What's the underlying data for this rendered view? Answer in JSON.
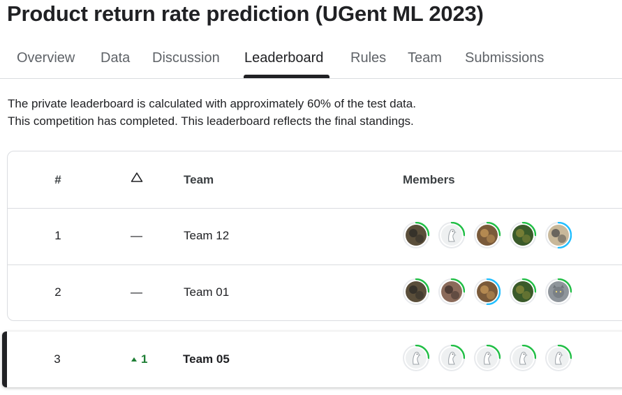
{
  "page": {
    "title": "Product return rate prediction (UGent ML 2023)"
  },
  "tabs": [
    {
      "label": "Overview"
    },
    {
      "label": "Data"
    },
    {
      "label": "Discussion"
    },
    {
      "label": "Leaderboard",
      "active": true
    },
    {
      "label": "Rules"
    },
    {
      "label": "Team"
    },
    {
      "label": "Submissions"
    }
  ],
  "description": {
    "line1": "The private leaderboard is calculated with approximately 60% of the test data.",
    "line2": "This competition has completed. This leaderboard reflects the final standings."
  },
  "leaderboard": {
    "headers": {
      "rank": "#",
      "delta_icon": "triangle-up-outline-icon",
      "team": "Team",
      "members": "Members"
    },
    "rows": [
      {
        "rank": "1",
        "delta": "—",
        "team": "Team 12",
        "highlighted": false,
        "members": [
          {
            "avatar": "photo-avatar",
            "tier_ring": "green",
            "progress": 0.25
          },
          {
            "avatar": "goose-default-avatar",
            "tier_ring": "green",
            "progress": 0.25
          },
          {
            "avatar": "photo-avatar",
            "tier_ring": "green",
            "progress": 0.25
          },
          {
            "avatar": "photo-avatar",
            "tier_ring": "green",
            "progress": 0.25
          },
          {
            "avatar": "photo-avatar",
            "tier_ring": "blue",
            "progress": 0.5
          }
        ]
      },
      {
        "rank": "2",
        "delta": "—",
        "team": "Team 01",
        "highlighted": false,
        "members": [
          {
            "avatar": "photo-avatar",
            "tier_ring": "green",
            "progress": 0.25
          },
          {
            "avatar": "photo-avatar",
            "tier_ring": "green",
            "progress": 0.25
          },
          {
            "avatar": "photo-avatar",
            "tier_ring": "blue",
            "progress": 0.5
          },
          {
            "avatar": "photo-avatar",
            "tier_ring": "green",
            "progress": 0.25
          },
          {
            "avatar": "cat-photo-avatar",
            "tier_ring": "green",
            "progress": 0.25
          }
        ]
      },
      {
        "rank": "3",
        "delta": "1",
        "delta_icon": "caret-up-icon",
        "team": "Team 05",
        "highlighted": true,
        "members": [
          {
            "avatar": "goose-default-avatar",
            "tier_ring": "green",
            "progress": 0.25
          },
          {
            "avatar": "goose-default-avatar",
            "tier_ring": "green",
            "progress": 0.25
          },
          {
            "avatar": "goose-default-avatar",
            "tier_ring": "green",
            "progress": 0.25
          },
          {
            "avatar": "goose-default-avatar",
            "tier_ring": "green",
            "progress": 0.25
          },
          {
            "avatar": "goose-default-avatar",
            "tier_ring": "green",
            "progress": 0.25
          }
        ]
      }
    ]
  },
  "colors": {
    "ring_green": "#20be45",
    "ring_blue": "#20beff",
    "delta_up": "#1e7e34",
    "highlight_bar": "#202124"
  }
}
